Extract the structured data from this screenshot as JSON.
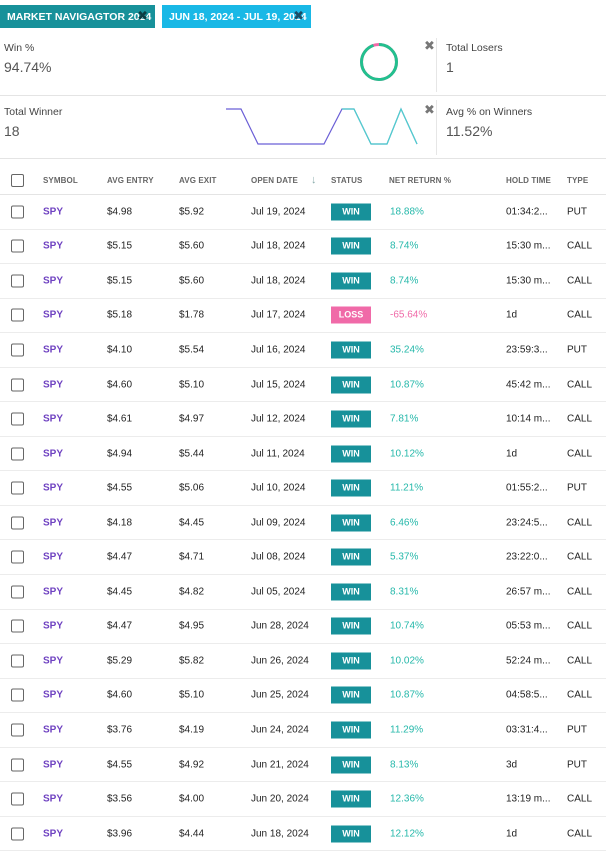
{
  "filters": [
    {
      "label": "MARKET NAVIGAGTOR 2024",
      "close": "✖"
    },
    {
      "label": "JUN 18, 2024 - JUL 19, 2024",
      "close": "✖"
    }
  ],
  "stats": {
    "win_pct": {
      "label": "Win %",
      "value": "94.74%",
      "fraction": 0.9474
    },
    "total_losers": {
      "label": "Total Losers",
      "value": "1"
    },
    "total_winner": {
      "label": "Total Winner",
      "value": "18"
    },
    "avg_pct_winners": {
      "label": "Avg % on Winners",
      "value": "11.52%"
    },
    "close_symbol": "✖"
  },
  "colors": {
    "accent": "#17919a",
    "date_tag": "#19b8e6",
    "win": "#17919a",
    "loss": "#f06aa8",
    "positive_return": "#25b8aa",
    "symbol": "#6f42c1"
  },
  "table": {
    "headers": {
      "symbol": "SYMBOL",
      "avg_entry": "AVG ENTRY",
      "avg_exit": "AVG EXIT",
      "open_date": "OPEN DATE",
      "status": "STATUS",
      "net_return": "NET RETURN %",
      "hold_time": "HOLD TIME",
      "type": "TYPE"
    },
    "sort_icon": "sort-down-arrow-icon",
    "rows": [
      {
        "symbol": "SPY",
        "entry": "$4.98",
        "exit": "$5.92",
        "date": "Jul 19, 2024",
        "status": "WIN",
        "ret": "18.88%",
        "hold": "01:34:2...",
        "type": "PUT"
      },
      {
        "symbol": "SPY",
        "entry": "$5.15",
        "exit": "$5.60",
        "date": "Jul 18, 2024",
        "status": "WIN",
        "ret": "8.74%",
        "hold": "15:30 m...",
        "type": "CALL"
      },
      {
        "symbol": "SPY",
        "entry": "$5.15",
        "exit": "$5.60",
        "date": "Jul 18, 2024",
        "status": "WIN",
        "ret": "8.74%",
        "hold": "15:30 m...",
        "type": "CALL"
      },
      {
        "symbol": "SPY",
        "entry": "$5.18",
        "exit": "$1.78",
        "date": "Jul 17, 2024",
        "status": "LOSS",
        "ret": "-65.64%",
        "hold": "1d",
        "type": "CALL"
      },
      {
        "symbol": "SPY",
        "entry": "$4.10",
        "exit": "$5.54",
        "date": "Jul 16, 2024",
        "status": "WIN",
        "ret": "35.24%",
        "hold": "23:59:3...",
        "type": "PUT"
      },
      {
        "symbol": "SPY",
        "entry": "$4.60",
        "exit": "$5.10",
        "date": "Jul 15, 2024",
        "status": "WIN",
        "ret": "10.87%",
        "hold": "45:42 m...",
        "type": "CALL"
      },
      {
        "symbol": "SPY",
        "entry": "$4.61",
        "exit": "$4.97",
        "date": "Jul 12, 2024",
        "status": "WIN",
        "ret": "7.81%",
        "hold": "10:14 m...",
        "type": "CALL"
      },
      {
        "symbol": "SPY",
        "entry": "$4.94",
        "exit": "$5.44",
        "date": "Jul 11, 2024",
        "status": "WIN",
        "ret": "10.12%",
        "hold": "1d",
        "type": "CALL"
      },
      {
        "symbol": "SPY",
        "entry": "$4.55",
        "exit": "$5.06",
        "date": "Jul 10, 2024",
        "status": "WIN",
        "ret": "11.21%",
        "hold": "01:55:2...",
        "type": "PUT"
      },
      {
        "symbol": "SPY",
        "entry": "$4.18",
        "exit": "$4.45",
        "date": "Jul 09, 2024",
        "status": "WIN",
        "ret": "6.46%",
        "hold": "23:24:5...",
        "type": "CALL"
      },
      {
        "symbol": "SPY",
        "entry": "$4.47",
        "exit": "$4.71",
        "date": "Jul 08, 2024",
        "status": "WIN",
        "ret": "5.37%",
        "hold": "23:22:0...",
        "type": "CALL"
      },
      {
        "symbol": "SPY",
        "entry": "$4.45",
        "exit": "$4.82",
        "date": "Jul 05, 2024",
        "status": "WIN",
        "ret": "8.31%",
        "hold": "26:57 m...",
        "type": "CALL"
      },
      {
        "symbol": "SPY",
        "entry": "$4.47",
        "exit": "$4.95",
        "date": "Jun 28, 2024",
        "status": "WIN",
        "ret": "10.74%",
        "hold": "05:53 m...",
        "type": "CALL"
      },
      {
        "symbol": "SPY",
        "entry": "$5.29",
        "exit": "$5.82",
        "date": "Jun 26, 2024",
        "status": "WIN",
        "ret": "10.02%",
        "hold": "52:24 m...",
        "type": "CALL"
      },
      {
        "symbol": "SPY",
        "entry": "$4.60",
        "exit": "$5.10",
        "date": "Jun 25, 2024",
        "status": "WIN",
        "ret": "10.87%",
        "hold": "04:58:5...",
        "type": "CALL"
      },
      {
        "symbol": "SPY",
        "entry": "$3.76",
        "exit": "$4.19",
        "date": "Jun 24, 2024",
        "status": "WIN",
        "ret": "11.29%",
        "hold": "03:31:4...",
        "type": "PUT"
      },
      {
        "symbol": "SPY",
        "entry": "$4.55",
        "exit": "$4.92",
        "date": "Jun 21, 2024",
        "status": "WIN",
        "ret": "8.13%",
        "hold": "3d",
        "type": "PUT"
      },
      {
        "symbol": "SPY",
        "entry": "$3.56",
        "exit": "$4.00",
        "date": "Jun 20, 2024",
        "status": "WIN",
        "ret": "12.36%",
        "hold": "13:19 m...",
        "type": "CALL"
      },
      {
        "symbol": "SPY",
        "entry": "$3.96",
        "exit": "$4.44",
        "date": "Jun 18, 2024",
        "status": "WIN",
        "ret": "12.12%",
        "hold": "1d",
        "type": "CALL"
      }
    ]
  }
}
